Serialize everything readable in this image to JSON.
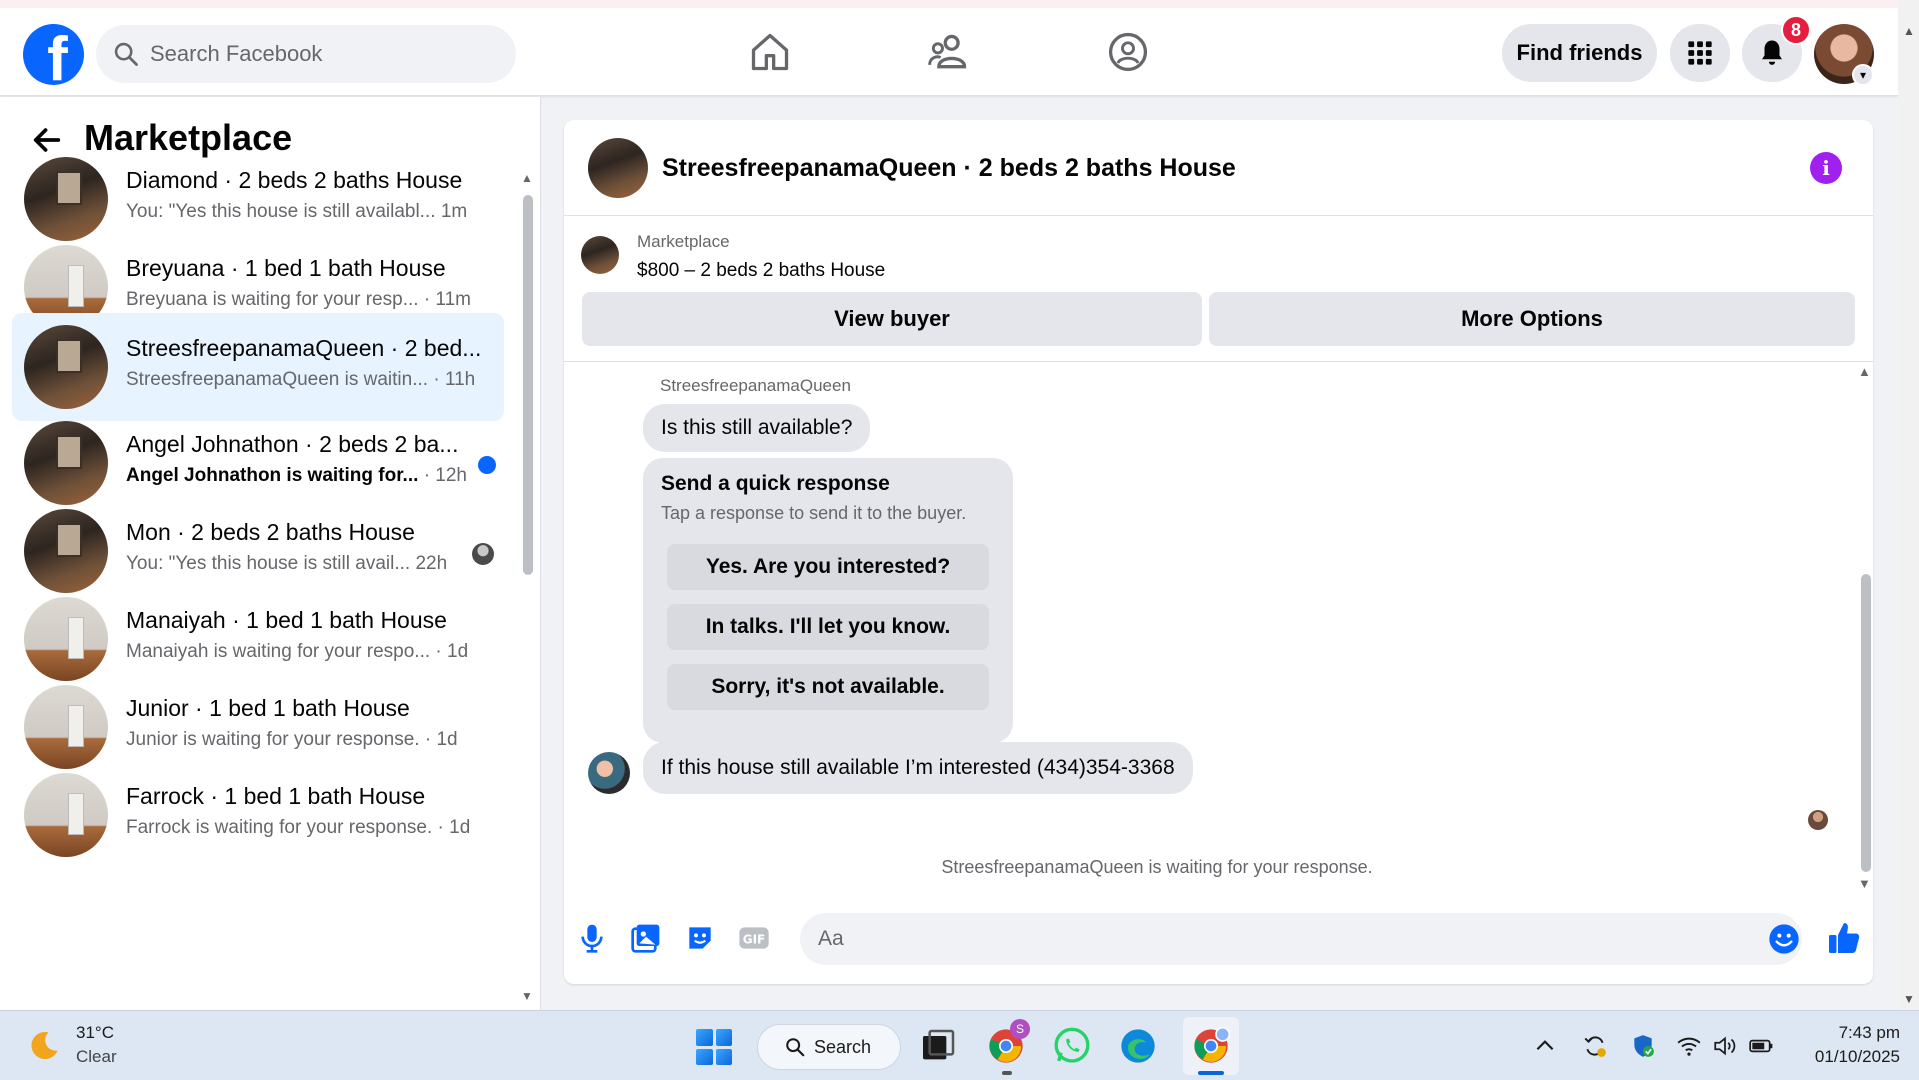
{
  "header": {
    "logo_letter": "f",
    "search_placeholder": "Search Facebook",
    "find_friends_label": "Find friends",
    "notification_count": "8"
  },
  "sidebar": {
    "title": "Marketplace",
    "conversations": [
      {
        "title": "Diamond · 2 beds 2 baths House",
        "preview": "You: \"Yes this house is still availabl...",
        "time": "1m",
        "thumb": "dark",
        "active": false,
        "unread": false
      },
      {
        "title": "Breyuana · 1 bed 1 bath House",
        "preview": "Breyuana is waiting for your resp...",
        "time": "· 11m",
        "thumb": "light",
        "active": false,
        "unread": false
      },
      {
        "title": "StreesfreepanamaQueen · 2 bed...",
        "preview": "StreesfreepanamaQueen is waitin...",
        "time": "· 11h",
        "thumb": "dark",
        "active": true,
        "unread": false
      },
      {
        "title": "Angel Johnathon · 2 beds 2 ba...",
        "preview": "Angel Johnathon is waiting for...",
        "time": "· 12h",
        "thumb": "dark",
        "active": false,
        "unread": true
      },
      {
        "title": "Mon · 2 beds 2 baths House",
        "preview": "You: \"Yes this house is still avail...",
        "time": "22h",
        "thumb": "dark",
        "active": false,
        "unread": false
      },
      {
        "title": "Manaiyah · 1 bed 1 bath House",
        "preview": "Manaiyah is waiting for your respo...",
        "time": "· 1d",
        "thumb": "light",
        "active": false,
        "unread": false
      },
      {
        "title": "Junior · 1 bed 1 bath House",
        "preview": "Junior is waiting for your response.",
        "time": "· 1d",
        "thumb": "light",
        "active": false,
        "unread": false
      },
      {
        "title": "Farrock · 1 bed 1 bath House",
        "preview": "Farrock is waiting for your response.",
        "time": "· 1d",
        "thumb": "light",
        "active": false,
        "unread": false
      }
    ]
  },
  "conversation": {
    "title": "StreesfreepanamaQueen · 2 beds 2 baths House",
    "listing_label": "Marketplace",
    "listing_price": "$800 – 2 beds 2 baths House",
    "view_buyer_label": "View buyer",
    "more_options_label": "More Options",
    "sender_name": "StreesfreepanamaQueen",
    "message_1": "Is this still available?",
    "quick_title": "Send a quick response",
    "quick_subtitle": "Tap a response to send it to the buyer.",
    "quick_replies": [
      "Yes. Are you interested?",
      "In talks. I'll let you know.",
      "Sorry, it's not available."
    ],
    "message_2": "If this house still available I’m interested (434)354-3368",
    "waiting_text": "StreesfreepanamaQueen is waiting for your response.",
    "composer_placeholder": "Aa"
  },
  "taskbar": {
    "temperature": "31°C",
    "weather": "Clear",
    "search_label": "Search",
    "time": "7:43 pm",
    "date": "01/10/2025",
    "chrome_badge": "S"
  },
  "colors": {
    "brand": "#0866ff",
    "active_row": "#e7f3ff",
    "notification_badge": "#e41e3f",
    "info_icon": "#a020f0"
  }
}
